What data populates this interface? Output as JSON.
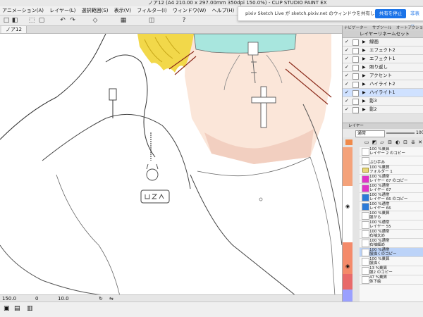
{
  "app": {
    "title": "ノア12 (A4 210.00 x 297.00mm 350dpi 150.0%) - CLIP STUDIO PAINT EX"
  },
  "menu": {
    "items": [
      {
        "label": "アニメーション(A)"
      },
      {
        "label": "レイヤー(L)"
      },
      {
        "label": "選択範囲(S)"
      },
      {
        "label": "表示(V)"
      },
      {
        "label": "フィルター(I)"
      },
      {
        "label": "ウィンドウ(W)"
      },
      {
        "label": "ヘルプ(H)"
      }
    ]
  },
  "toolbar": {
    "icons": [
      "new-icon",
      "save-icon",
      "undo-icon",
      "redo-icon",
      "clear-icon",
      "transform-icon",
      "select-icon",
      "grid-icon",
      "ruler-icon",
      "help-icon"
    ]
  },
  "document_tab": {
    "label": "ノア12"
  },
  "share_bar": {
    "message": "pixiv Sketch Live が sketch.pixiv.net のウィンドウを共有しています。",
    "stop_label": "共有を停止",
    "hide_label": "非表示"
  },
  "right_panel": {
    "tabs": [
      {
        "label": "ナビゲーター"
      },
      {
        "label": "サブツール"
      },
      {
        "label": "オートアクション"
      }
    ],
    "layer_comp": {
      "title": "レイヤーリネームセット",
      "rows": [
        {
          "name": "線画"
        },
        {
          "name": "エフェクト2"
        },
        {
          "name": "エフェクト1"
        },
        {
          "name": "照り返し"
        },
        {
          "name": "アクセント"
        },
        {
          "name": "ハイライト2"
        },
        {
          "name": "ハイライト1",
          "selected": true
        },
        {
          "name": "影3"
        },
        {
          "name": "影2"
        }
      ]
    },
    "layer_panel": {
      "title": "レイヤー",
      "blend_mode": "通常",
      "opacity": "100",
      "tool_icons": [
        "new-layer-icon",
        "new-vector-icon",
        "new-folder-icon",
        "clip-icon",
        "mask-icon",
        "lock-icon",
        "merge-icon",
        "trash-icon"
      ],
      "layers": [
        {
          "line1": "100 %乗算",
          "line2": "レイヤー 2 のコピー"
        },
        {
          "line1": "",
          "line2": "ぶひ手み"
        },
        {
          "line1": "100 %乗算",
          "line2": "フォルダー 1"
        },
        {
          "line1": "100 %通常",
          "line2": "レイヤー 67 のコピー"
        },
        {
          "line1": "100 %通常",
          "line2": "レイヤー 67"
        },
        {
          "line1": "100 %通常",
          "line2": "レイヤー 66 のコピー"
        },
        {
          "line1": "100 %通常",
          "line2": "レイヤー 66"
        },
        {
          "line1": "100 %乗算",
          "line2": "服がら"
        },
        {
          "line1": "100 %通常",
          "line2": "レイヤー 55"
        },
        {
          "line1": "100 %通常",
          "line2": "右袖太め"
        },
        {
          "line1": "100 %通常",
          "line2": "右袖細め"
        },
        {
          "line1": "100 %通常",
          "line2": "服描くのコピー",
          "highlighted": true
        },
        {
          "line1": "100 %乗算",
          "line2": "服描く"
        },
        {
          "line1": "13 %乗算",
          "line2": "服2 のコピー"
        },
        {
          "line1": "47 %乗算",
          "line2": "体下絵"
        }
      ],
      "color_bars": [
        "#f4a27a",
        "#ffffff",
        "#f48a6a",
        "#e86a6a",
        "#9aa0ff"
      ]
    }
  },
  "status": {
    "zoom": "150.0",
    "angle": "0",
    "brush_size": "10.0"
  }
}
